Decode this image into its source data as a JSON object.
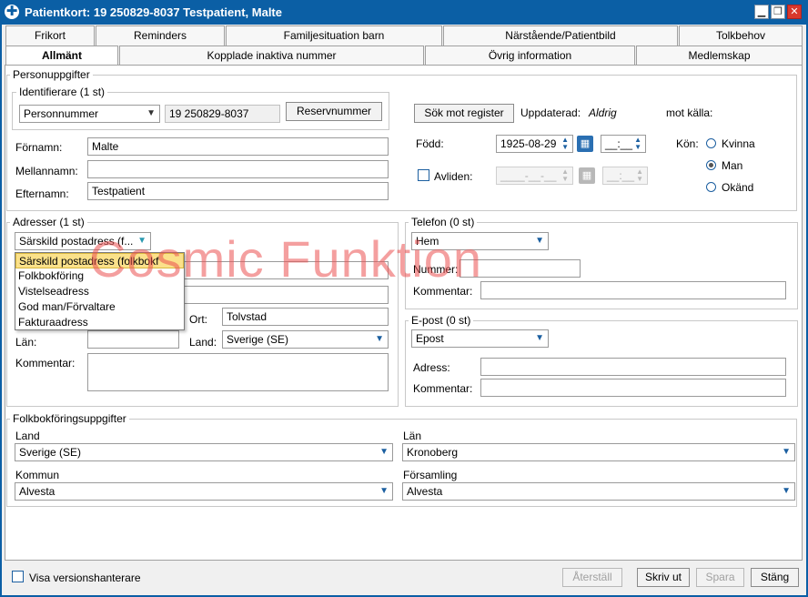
{
  "window": {
    "title": "Patientkort: 19 250829-8037 Testpatient, Malte",
    "app_icon": "plus-cross-icon",
    "minimize_label": "▁",
    "restore_label": "❐",
    "close_label": "✕"
  },
  "tabs_row1": [
    "Frikort",
    "Reminders",
    "Familjesituation barn",
    "Närstående/Patientbild",
    "Tolkbehov"
  ],
  "tabs_row2": [
    "Allmänt",
    "Kopplade inaktiva nummer",
    "Övrig information",
    "Medlemskap"
  ],
  "person": {
    "legend": "Personuppgifter",
    "identifiers_legend": "Identifierare (1 st)",
    "id_type": "Personnummer",
    "id_value": "19 250829-8037",
    "reserve_button": "Reservnummer",
    "search_register_button": "Sök mot register",
    "updated_label": "Uppdaterad:",
    "updated_value": "Aldrig",
    "source_label": "mot källa:",
    "firstname_label": "Förnamn:",
    "firstname": "Malte",
    "middlename_label": "Mellannamn:",
    "middlename": "",
    "lastname_label": "Efternamn:",
    "lastname": "Testpatient",
    "born_label": "Född:",
    "born_date": "1925-08-29",
    "born_time": "__:__",
    "deceased_label": "Avliden:",
    "deceased_date": "____-__-__",
    "deceased_time": "__:__",
    "gender_label": "Kön:",
    "genders": [
      "Kvinna",
      "Man",
      "Okänd"
    ],
    "gender_selected": "Man"
  },
  "address": {
    "legend": "Adresser (1 st)",
    "type_selected": "Särskild postadress (f...",
    "dropdown_options": [
      "Särskild postadress (folkbokf",
      "Folkbokföring",
      "Vistelseadress",
      "God man/Förvaltare",
      "Fakturaadress"
    ],
    "city_label": "Ort:",
    "city": "Tolvstad",
    "county_label": "Län:",
    "county": "",
    "country_label": "Land:",
    "country": "Sverige (SE)",
    "comment_label": "Kommentar:",
    "comment": ""
  },
  "phone": {
    "legend": "Telefon (0 st)",
    "type": "Hem",
    "number_label": "Nummer:",
    "number": "",
    "comment_label": "Kommentar:",
    "comment": ""
  },
  "email": {
    "legend": "E-post (0 st)",
    "type": "Epost",
    "address_label": "Adress:",
    "address": "",
    "comment_label": "Kommentar:",
    "comment": ""
  },
  "registration": {
    "legend": "Folkbokföringsuppgifter",
    "country_label": "Land",
    "country": "Sverige (SE)",
    "county_label": "Län",
    "county": "Kronoberg",
    "municipality_label": "Kommun",
    "municipality": "Alvesta",
    "parish_label": "Församling",
    "parish": "Alvesta"
  },
  "footer": {
    "show_versions_label": "Visa versionshanterare",
    "restore_button": "Återställ",
    "print_button": "Skriv ut",
    "save_button": "Spara",
    "close_button": "Stäng"
  },
  "watermark": "Cosmic Funktion",
  "colors": {
    "titlebar": "#0b5fa5",
    "dropdown_highlight": "#fbe18a",
    "watermark": "#eb5050"
  }
}
